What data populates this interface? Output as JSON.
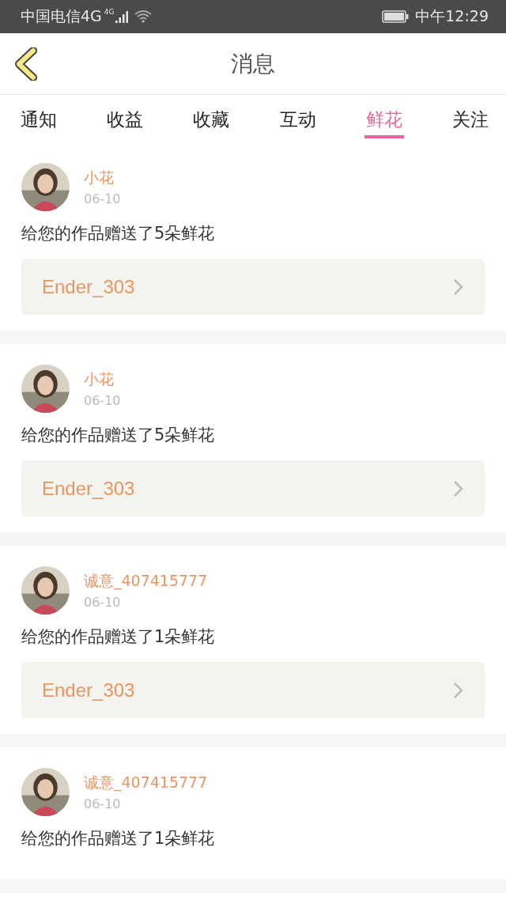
{
  "status_bar": {
    "carrier": "中国电信4G",
    "network": "4G",
    "time": "中午12:29"
  },
  "header": {
    "title": "消息"
  },
  "tabs": [
    {
      "label": "通知",
      "selected": false
    },
    {
      "label": "收益",
      "selected": false
    },
    {
      "label": "收藏",
      "selected": false
    },
    {
      "label": "互动",
      "selected": false
    },
    {
      "label": "鲜花",
      "selected": true
    },
    {
      "label": "关注",
      "selected": false
    }
  ],
  "messages": [
    {
      "sender": "小花",
      "date": "06-10",
      "text": "给您的作品赠送了5朵鲜花",
      "work": "Ender_303"
    },
    {
      "sender": "小花",
      "date": "06-10",
      "text": "给您的作品赠送了5朵鲜花",
      "work": "Ender_303"
    },
    {
      "sender": "诚意_407415777",
      "date": "06-10",
      "text": "给您的作品赠送了1朵鲜花",
      "work": "Ender_303"
    },
    {
      "sender": "诚意_407415777",
      "date": "06-10",
      "text": "给您的作品赠送了1朵鲜花"
    }
  ]
}
